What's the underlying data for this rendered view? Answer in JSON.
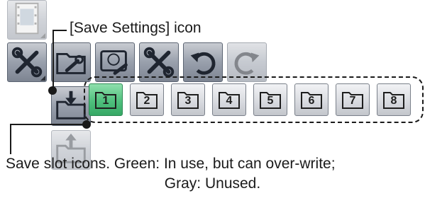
{
  "callouts": {
    "save_settings": "[Save Settings] icon",
    "slots_line1": "Save slot icons. Green: In use, but can over-write;",
    "slots_line2": "Gray: Unused."
  },
  "toolbar": {
    "tiles": [
      {
        "name": "film-icon"
      },
      {
        "name": "tools-icon"
      },
      {
        "name": "folder-wrench-icon"
      },
      {
        "name": "drive-wrench-icon"
      },
      {
        "name": "settings-wrench-icon"
      },
      {
        "name": "undo-icon"
      },
      {
        "name": "redo-icon"
      },
      {
        "name": "save-settings-icon"
      },
      {
        "name": "load-settings-icon"
      }
    ]
  },
  "slots": [
    {
      "label": "1",
      "state": "in-use"
    },
    {
      "label": "2",
      "state": "unused"
    },
    {
      "label": "3",
      "state": "unused"
    },
    {
      "label": "4",
      "state": "unused"
    },
    {
      "label": "5",
      "state": "unused"
    },
    {
      "label": "6",
      "state": "unused"
    },
    {
      "label": "7",
      "state": "unused"
    },
    {
      "label": "8",
      "state": "unused"
    }
  ],
  "colors": {
    "in_use": "#4fbf7d",
    "unused": "#d9dbe0",
    "tile": "#9aa1ad"
  }
}
